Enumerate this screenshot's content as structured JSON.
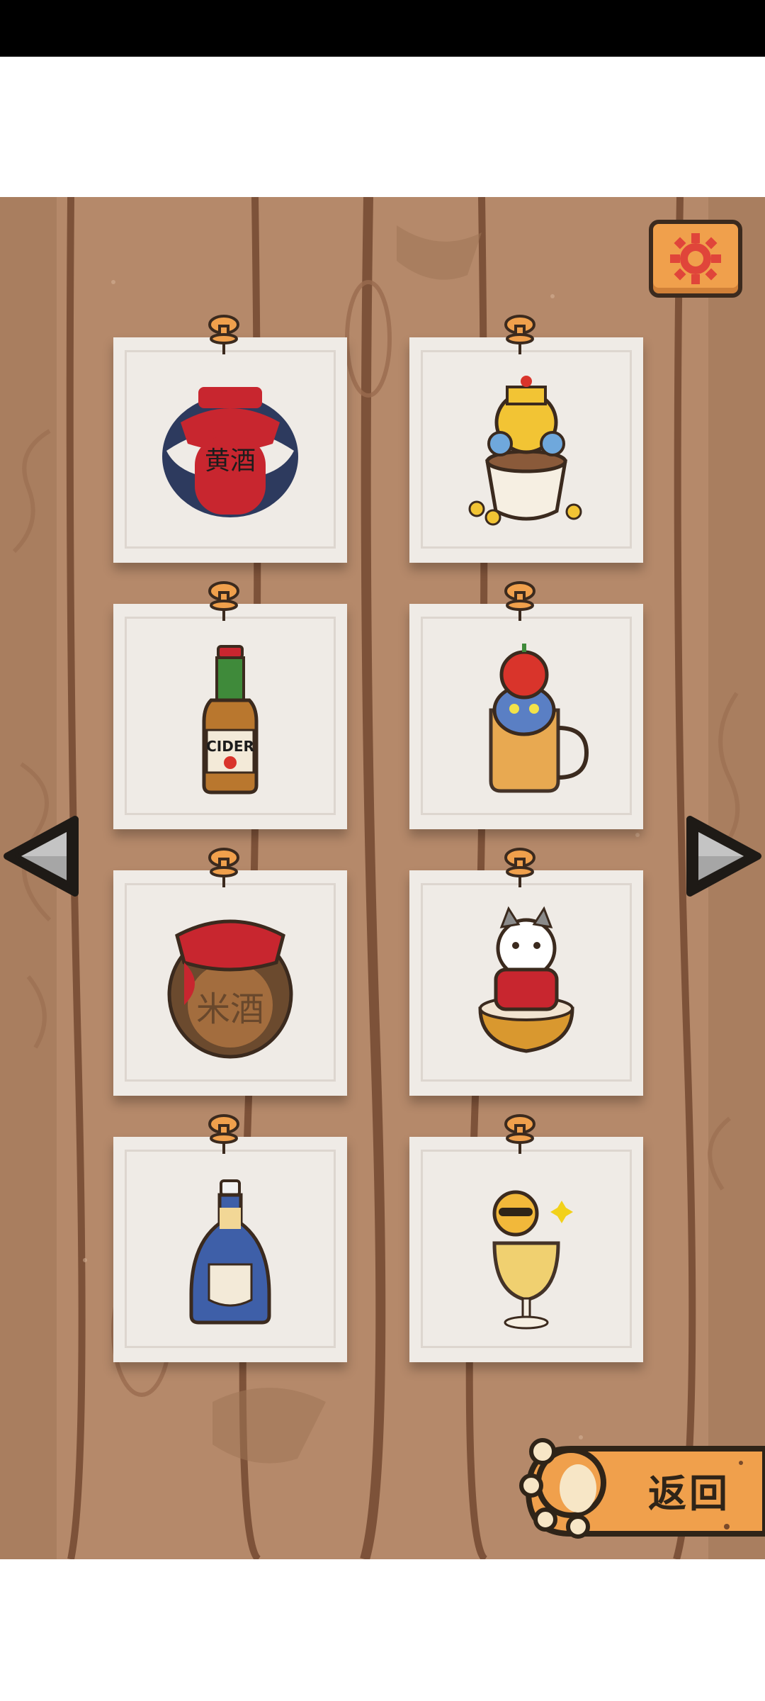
{
  "colors": {
    "wood_base": "#b5896a",
    "wood_dark": "#8a5e43",
    "card": "#efebe6",
    "accent_orange": "#f0a04c",
    "outline": "#3b2a1e"
  },
  "settings": {
    "icon": "gear-icon"
  },
  "cards": [
    {
      "item": "huangjiu-jar",
      "label": "黄酒"
    },
    {
      "item": "emperor-cat-teacup"
    },
    {
      "item": "cider-bottle",
      "label": "CIDER"
    },
    {
      "item": "apple-hat-cat-mug"
    },
    {
      "item": "mijiu-jar",
      "label": "米酒"
    },
    {
      "item": "red-jacket-cat-bowl"
    },
    {
      "item": "whisky-bottle"
    },
    {
      "item": "sunglasses-cat-goblet"
    }
  ],
  "nav": {
    "prev_icon": "left-arrow-icon",
    "next_icon": "right-arrow-icon"
  },
  "back": {
    "label": "返回",
    "icon": "paw-icon"
  }
}
